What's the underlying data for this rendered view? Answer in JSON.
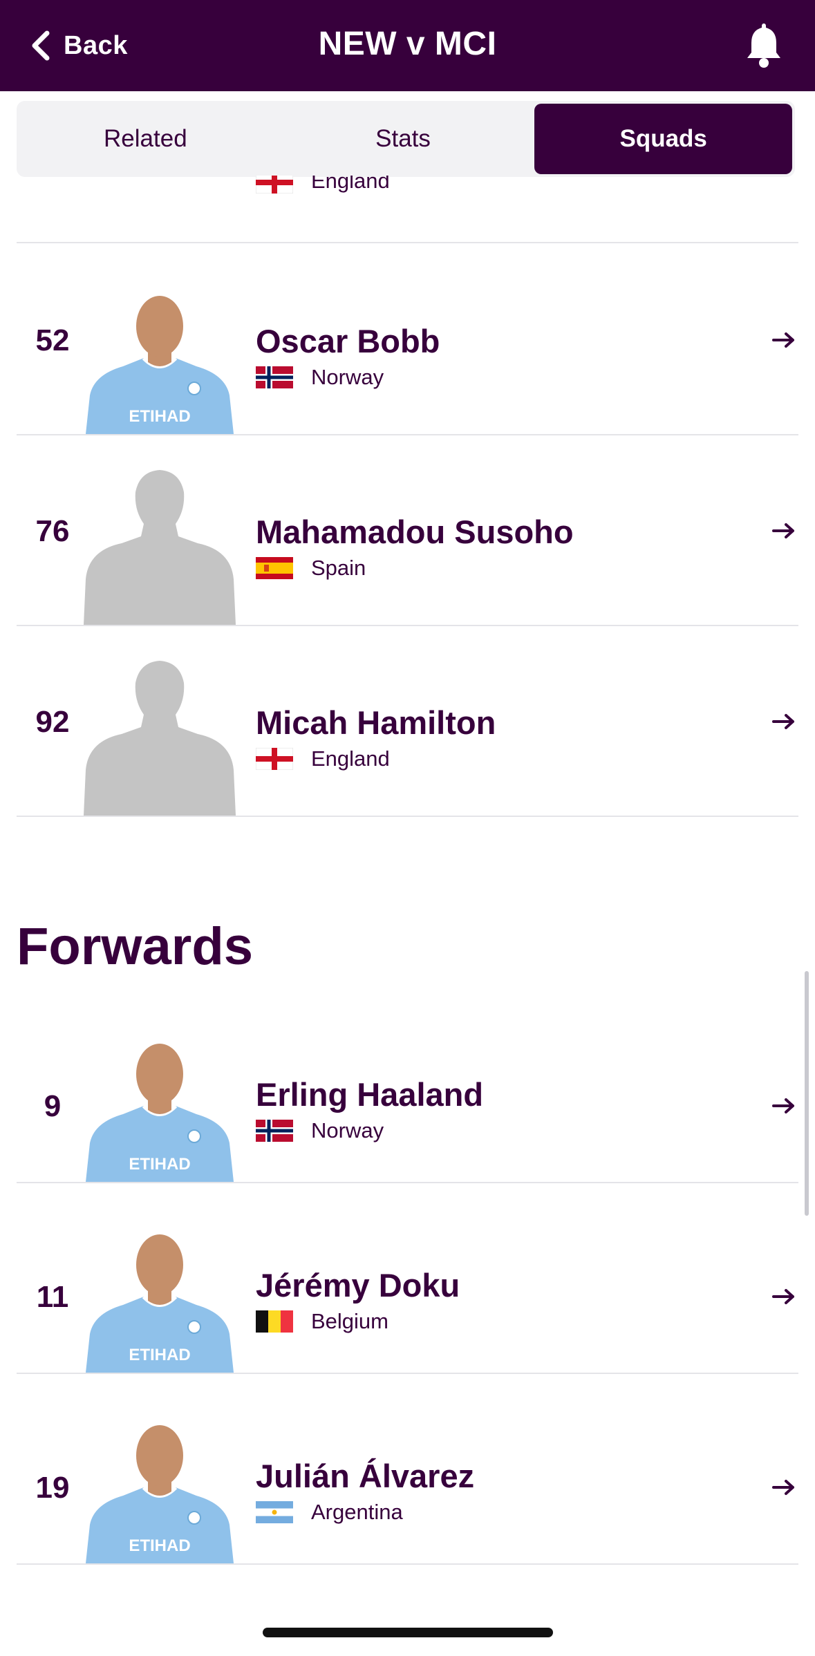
{
  "header": {
    "back_label": "Back",
    "title": "NEW v MCI",
    "background": "#37003c",
    "icons": [
      "chevron-left-icon",
      "bell-icon"
    ]
  },
  "tabs": [
    {
      "label": "Related",
      "active": false
    },
    {
      "label": "Stats",
      "active": false
    },
    {
      "label": "Squads",
      "active": true
    }
  ],
  "partial_row": {
    "nationality": "England"
  },
  "midfielders": [
    {
      "number": "52",
      "name": "Oscar Bobb",
      "nationality": "Norway",
      "photo": "player-photo"
    },
    {
      "number": "76",
      "name": "Mahamadou Susoho",
      "nationality": "Spain",
      "photo": "silhouette"
    },
    {
      "number": "92",
      "name": "Micah Hamilton",
      "nationality": "England",
      "photo": "silhouette"
    }
  ],
  "forwards": {
    "title": "Forwards",
    "players": [
      {
        "number": "9",
        "name": "Erling Haaland",
        "nationality": "Norway",
        "photo": "player-photo"
      },
      {
        "number": "11",
        "name": "Jérémy Doku",
        "nationality": "Belgium",
        "photo": "player-photo"
      },
      {
        "number": "19",
        "name": "Julián Álvarez",
        "nationality": "Argentina",
        "photo": "player-photo"
      }
    ]
  },
  "colors": {
    "brand_purple": "#37003c",
    "kit_sky_blue": "#8fc1ea",
    "silhouette_grey": "#c4c4c4"
  }
}
